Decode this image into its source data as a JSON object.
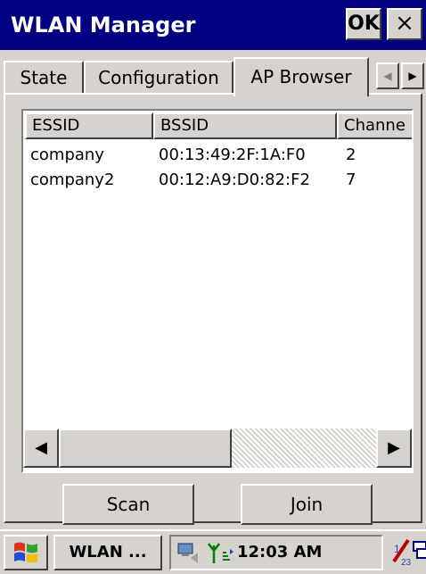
{
  "window": {
    "title": "WLAN Manager",
    "ok_label": "OK",
    "close_label": "×"
  },
  "tabs": [
    {
      "label": "State",
      "active": false
    },
    {
      "label": "Configuration",
      "active": false
    },
    {
      "label": "AP Browser",
      "active": true
    }
  ],
  "tab_scroll": {
    "left_icon": "chevron-left-icon",
    "right_icon": "chevron-right-icon"
  },
  "ap_list": {
    "columns": [
      "ESSID",
      "BSSID",
      "Channe"
    ],
    "rows": [
      {
        "essid": "company",
        "bssid": "00:13:49:2F:1A:F0",
        "channel": "2"
      },
      {
        "essid": "company2",
        "bssid": "00:12:A9:D0:82:F2",
        "channel": "7"
      }
    ],
    "hscroll_position": 0
  },
  "buttons": {
    "scan": "Scan",
    "join": "Join"
  },
  "taskbar": {
    "start_icon": "windows-flag-icon",
    "task_label": "WLAN ...",
    "time": "12:03 AM",
    "tray_icons": [
      "network-icon",
      "wifi-signal-icon",
      "input-panel-icon",
      "window-switch-icon"
    ]
  },
  "colors": {
    "titlebar": "#000080",
    "face": "#d6d3ce",
    "list_bg": "#ffffff"
  }
}
